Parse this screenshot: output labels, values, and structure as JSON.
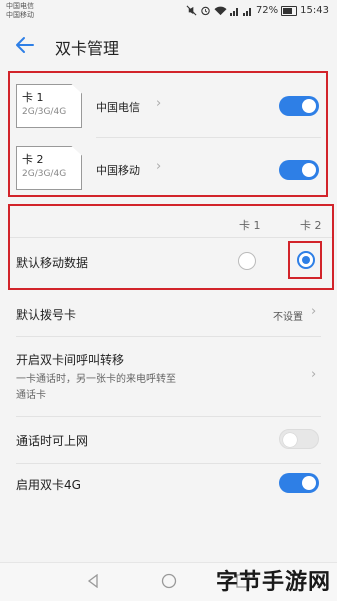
{
  "statusbar": {
    "carrier1": "中国电信",
    "carrier2": "中国移动",
    "battery": "72%",
    "time": "15:43",
    "icons": [
      "mute-icon",
      "alarm-icon",
      "wifi-icon",
      "signal-icon",
      "signal-icon",
      "battery-icon"
    ]
  },
  "header": {
    "title": "双卡管理",
    "back_icon": "back-arrow-icon"
  },
  "sims": [
    {
      "name": "卡 1",
      "bands": "2G/3G/4G",
      "carrier": "中国电信",
      "enabled": true
    },
    {
      "name": "卡 2",
      "bands": "2G/3G/4G",
      "carrier": "中国移动",
      "enabled": true
    }
  ],
  "default_data": {
    "col1": "卡 1",
    "col2": "卡 2",
    "label": "默认移动数据",
    "selected": "卡 2"
  },
  "default_dial": {
    "label": "默认拨号卡",
    "value": "不设置"
  },
  "forwarding": {
    "label": "开启双卡间呼叫转移",
    "desc_line1": "一卡通话时，另一张卡的来电呼转至",
    "desc_line2": "通话卡"
  },
  "internet_during_call": {
    "label": "通话时可上网",
    "enabled": false
  },
  "dual_4g": {
    "label": "启用双卡4G",
    "enabled": true
  },
  "watermark": "字节手游网",
  "colors": {
    "accent": "#2e7fe6",
    "highlight": "#d2232a"
  }
}
